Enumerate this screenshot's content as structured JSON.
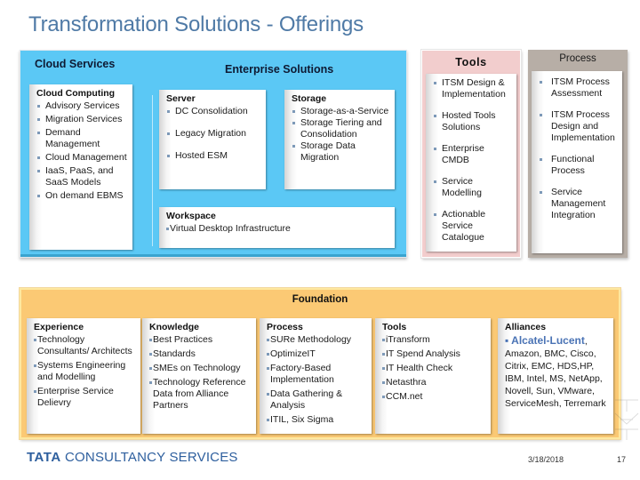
{
  "title": "Transformation Solutions - Offerings",
  "cloud_services": {
    "title": "Cloud Services",
    "card": {
      "heading": "Cloud Computing",
      "items": [
        "Advisory Services",
        "Migration Services",
        "Demand Management",
        "Cloud Management",
        "IaaS, PaaS, and SaaS Models",
        " On demand EBMS"
      ]
    }
  },
  "enterprise_solutions": {
    "title": "Enterprise Solutions",
    "server": {
      "heading": "Server",
      "items": [
        "DC Consolidation",
        " Legacy Migration",
        " Hosted ESM"
      ]
    },
    "storage": {
      "heading": "Storage",
      "items": [
        "Storage-as-a-Service",
        " Storage Tiering and Consolidation",
        " Storage Data Migration"
      ]
    },
    "workspace": {
      "heading": "Workspace",
      "items": [
        "Virtual Desktop Infrastructure"
      ]
    }
  },
  "tools": {
    "title": "Tools",
    "items": [
      "ITSM Design & Implementation",
      "Hosted Tools Solutions",
      "Enterprise CMDB",
      "Service Modelling",
      " Actionable Service Catalogue"
    ]
  },
  "process": {
    "title": "Process",
    "items": [
      "ITSM Process Assessment",
      "ITSM Process Design and Implementation",
      "Functional Process",
      "Service Management Integration"
    ]
  },
  "foundation": {
    "title": "Foundation",
    "experience": {
      "heading": "Experience",
      "items": [
        "Technology Consultants/ Architects",
        "Systems Engineering and Modelling",
        "Enterprise Service Delievry"
      ]
    },
    "knowledge": {
      "heading": "Knowledge",
      "items": [
        "Best Practices",
        "Standards",
        "SMEs on Technology",
        "Technology Reference Data from Alliance Partners"
      ]
    },
    "process": {
      "heading": "Process",
      "items": [
        "SURe Methodology",
        "OptimizeIT",
        "Factory-Based Implementation",
        "Data Gathering & Analysis",
        "ITIL, Six Sigma"
      ]
    },
    "tools": {
      "heading": "Tools",
      "items": [
        "iTransform",
        "IT Spend Analysis",
        "IT Health Check",
        "Netasthra",
        "CCM.net"
      ]
    },
    "alliances": {
      "heading": "Alliances",
      "highlight": "Alcatel-Lucent",
      "rest": ", Amazon, BMC, Cisco, Citrix, EMC, HDS,HP, IBM, Intel, MS, NetApp, Novell, Sun, VMware, ServiceMesh, Terremark"
    }
  },
  "footer": {
    "logo_bold": "TATA",
    "logo_rest": " CONSULTANCY SERVICES",
    "date": "3/18/2018",
    "page": "17"
  },
  "colors": {
    "title": "#4f7aa6",
    "blue_region": "#5bc8f5",
    "tools_bg": "#f2cdcd",
    "process_bg": "#b7aea6",
    "foundation_bg": "#fbc974",
    "alcatel": "#4a73b5"
  }
}
